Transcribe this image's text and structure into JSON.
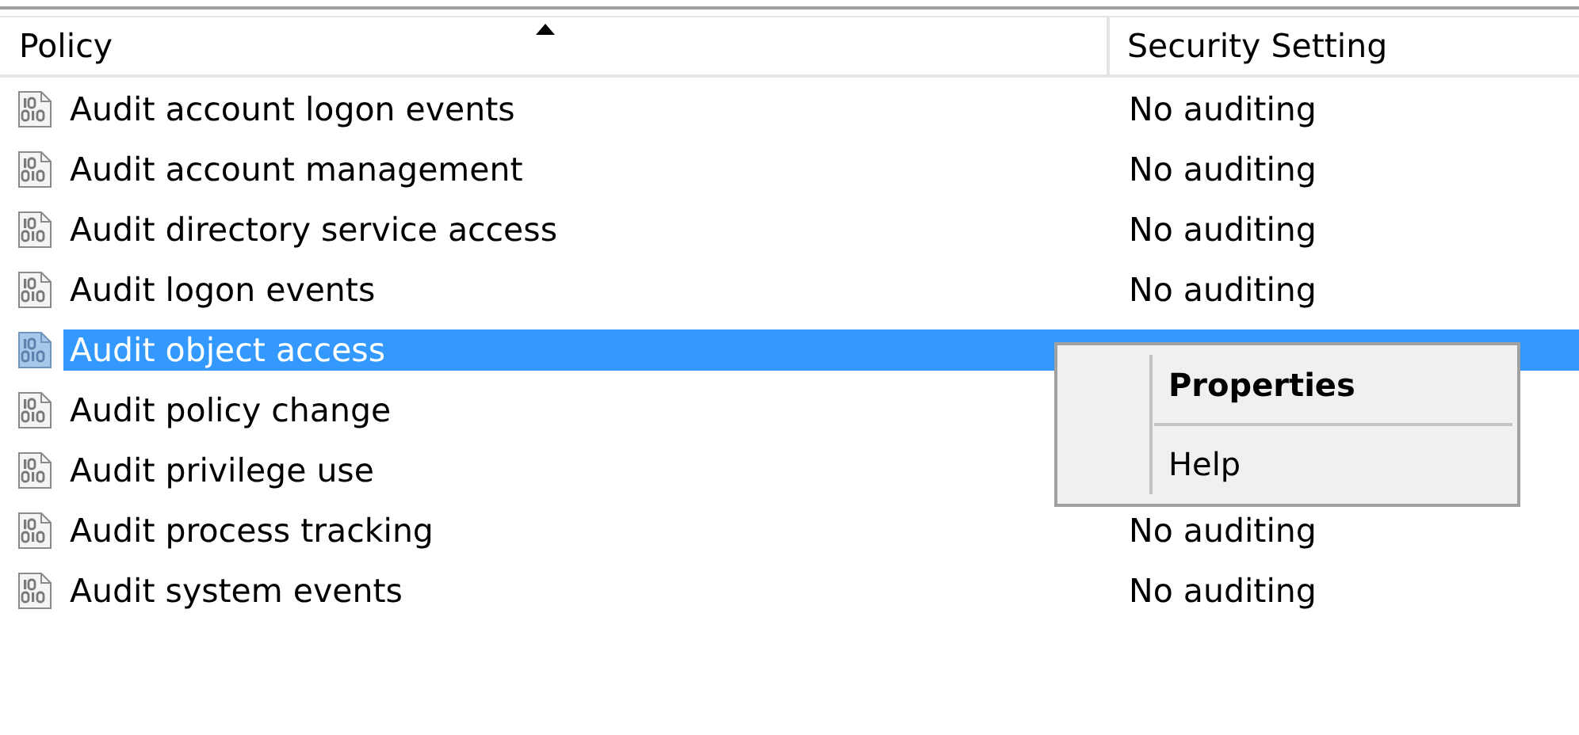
{
  "table": {
    "columns": [
      {
        "label": "Policy",
        "sorted": true
      },
      {
        "label": "Security Setting",
        "sorted": false
      }
    ],
    "rows": [
      {
        "policy": "Audit account logon events",
        "setting": "No auditing",
        "selected": false
      },
      {
        "policy": "Audit account management",
        "setting": "No auditing",
        "selected": false
      },
      {
        "policy": "Audit directory service access",
        "setting": "No auditing",
        "selected": false
      },
      {
        "policy": "Audit logon events",
        "setting": "No auditing",
        "selected": false
      },
      {
        "policy": "Audit object access",
        "selected": true
      },
      {
        "policy": "Audit policy change",
        "selected": false
      },
      {
        "policy": "Audit privilege use",
        "selected": false
      },
      {
        "policy": "Audit process tracking",
        "setting": "No auditing",
        "selected": false
      },
      {
        "policy": "Audit system events",
        "setting": "No auditing",
        "selected": false
      }
    ]
  },
  "context_menu": {
    "items": [
      {
        "label": "Properties",
        "kind": "default"
      },
      {
        "label": "Help",
        "kind": "normal"
      }
    ]
  }
}
